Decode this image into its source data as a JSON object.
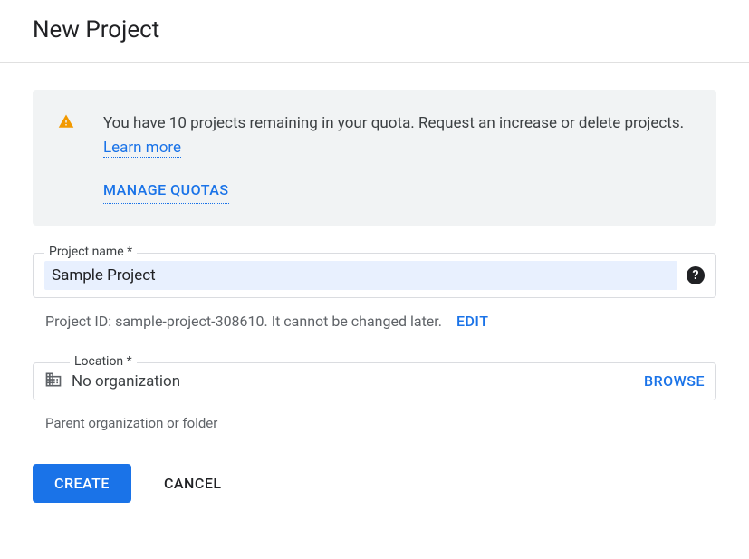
{
  "header": {
    "title": "New Project"
  },
  "banner": {
    "message_part1": "You have 10 projects remaining in your quota. Request an increase or delete projects. ",
    "learn_more": "Learn more",
    "manage_quotas": "MANAGE QUOTAS"
  },
  "project_name": {
    "label": "Project name *",
    "value": "Sample Project"
  },
  "project_id": {
    "prefix": "Project ID: ",
    "value": "sample-project-308610",
    "suffix": ". It cannot be changed later.",
    "edit_label": "EDIT"
  },
  "location": {
    "label": "Location *",
    "value": "No organization",
    "browse_label": "BROWSE",
    "help_text": "Parent organization or folder"
  },
  "buttons": {
    "create": "CREATE",
    "cancel": "CANCEL"
  }
}
